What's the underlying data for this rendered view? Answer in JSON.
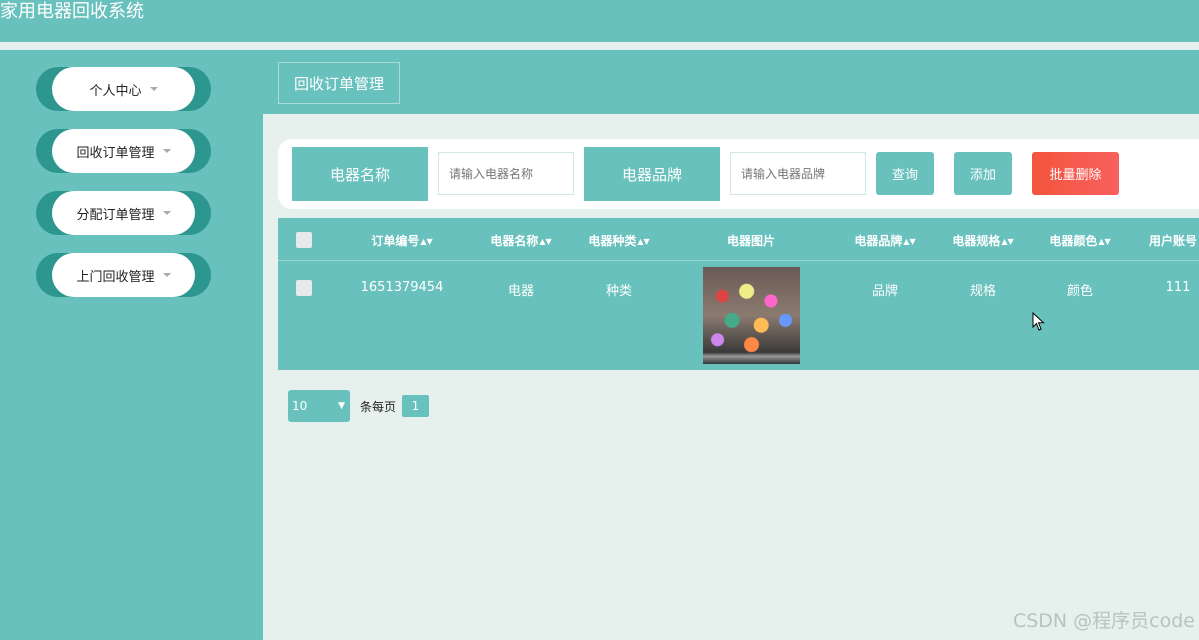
{
  "app": {
    "title": "家用电器回收系统"
  },
  "sidebar": {
    "items": [
      {
        "label": "个人中心"
      },
      {
        "label": "回收订单管理"
      },
      {
        "label": "分配订单管理"
      },
      {
        "label": "上门回收管理"
      }
    ]
  },
  "breadcrumb": {
    "label": "回收订单管理"
  },
  "search": {
    "name_label": "电器名称",
    "name_placeholder": "请输入电器名称",
    "brand_label": "电器品牌",
    "brand_placeholder": "请输入电器品牌",
    "query_button": "查询",
    "add_button": "添加",
    "batch_delete_button": "批量删除"
  },
  "table": {
    "columns": [
      "订单编号",
      "电器名称",
      "电器种类",
      "电器图片",
      "电器品牌",
      "电器规格",
      "电器颜色",
      "用户账号"
    ],
    "rows": [
      {
        "order_no": "1651379454",
        "name": "电器",
        "category": "种类",
        "brand": "品牌",
        "spec": "规格",
        "color": "颜色",
        "account": "111"
      }
    ]
  },
  "pager": {
    "page_size": "10",
    "per_page_label": "条每页",
    "current_page": "1"
  },
  "watermark": "CSDN @程序员code",
  "colors": {
    "primary": "#68c1bd",
    "menu_dark": "#2d968f",
    "danger": "#f2553d",
    "background": "#e6f0ec"
  }
}
